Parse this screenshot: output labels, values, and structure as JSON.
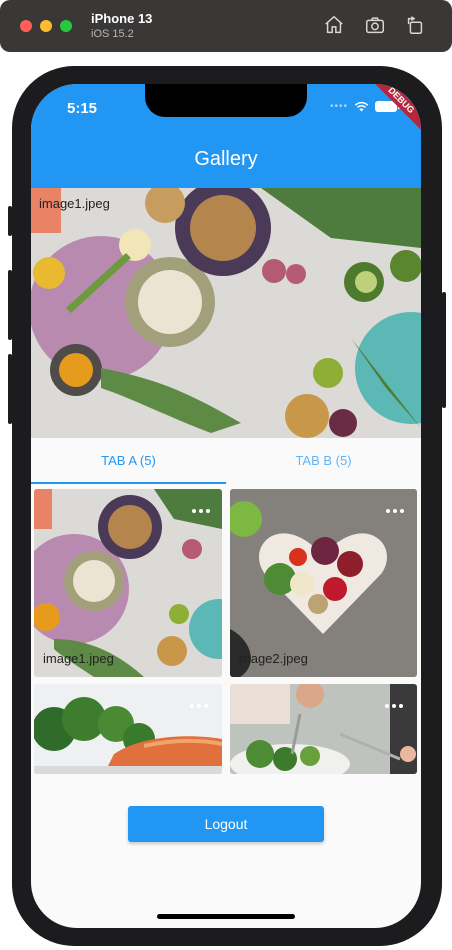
{
  "simulator": {
    "device": "iPhone 13",
    "os": "iOS 15.2",
    "icons": [
      "home-icon",
      "screenshot-icon",
      "rotate-icon"
    ]
  },
  "status_bar": {
    "time": "5:15",
    "debug_banner": "DEBUG"
  },
  "app_bar": {
    "title": "Gallery",
    "color": "#2196f3"
  },
  "hero": {
    "image_name": "image1.jpeg"
  },
  "tabs": [
    {
      "label": "TAB A (5)",
      "selected": true
    },
    {
      "label": "TAB B (5)",
      "selected": false
    }
  ],
  "grid": [
    {
      "image_name": "image1.jpeg"
    },
    {
      "image_name": "image2.jpeg"
    },
    {
      "image_name": ""
    },
    {
      "image_name": ""
    }
  ],
  "logout_label": "Logout"
}
